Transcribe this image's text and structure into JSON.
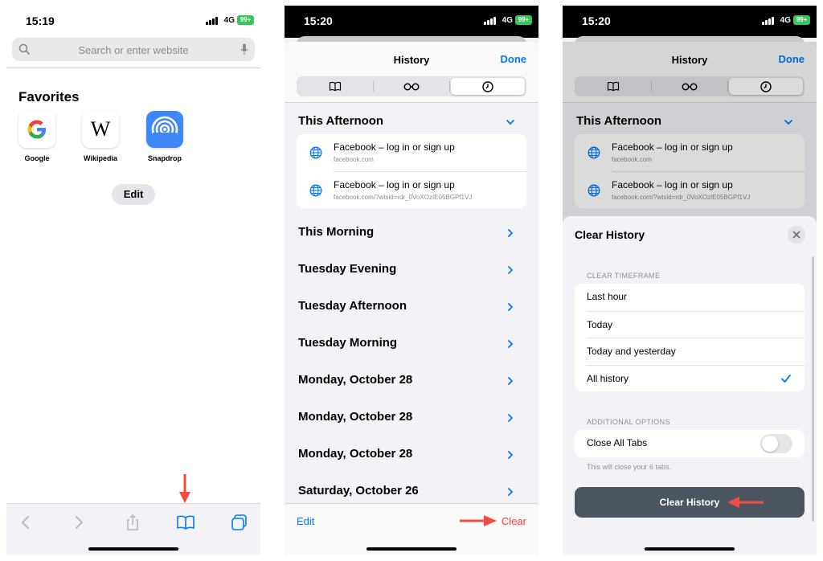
{
  "panel1": {
    "status": {
      "time": "15:19",
      "network": "4G",
      "battery": "99+"
    },
    "search": {
      "placeholder": "Search or enter website"
    },
    "favorites": {
      "title": "Favorites",
      "items": [
        {
          "label": "Google",
          "icon": "google-icon"
        },
        {
          "label": "Wikipedia",
          "icon": "wikipedia-icon"
        },
        {
          "label": "Snapdrop",
          "icon": "snapdrop-icon"
        }
      ]
    },
    "edit_label": "Edit"
  },
  "panel2": {
    "status": {
      "time": "15:20",
      "network": "4G",
      "battery": "99+"
    },
    "title": "History",
    "done_label": "Done",
    "sections": [
      "This Afternoon",
      "This Morning",
      "Tuesday Evening",
      "Tuesday Afternoon",
      "Tuesday Morning",
      "Monday, October 28",
      "Monday, October 28",
      "Monday, October 28",
      "Saturday, October 26"
    ],
    "entries": [
      {
        "title": "Facebook – log in or sign up",
        "url": "facebook.com"
      },
      {
        "title": "Facebook – log in or sign up",
        "url": "facebook.com/?wtsid=rdr_0VoXOzIE05BGPf1VJ"
      }
    ],
    "edit_label": "Edit",
    "clear_label": "Clear"
  },
  "panel3": {
    "status": {
      "time": "15:20",
      "network": "4G",
      "battery": "99+"
    },
    "title": "History",
    "done_label": "Done",
    "section": "This Afternoon",
    "entries": [
      {
        "title": "Facebook – log in or sign up",
        "url": "facebook.com"
      },
      {
        "title": "Facebook – log in or sign up",
        "url": "facebook.com/?wtsid=rdr_0VoXOzIE05BGPf1VJ"
      }
    ],
    "modal": {
      "title": "Clear History",
      "timeframe_header": "CLEAR TIMEFRAME",
      "options": [
        "Last hour",
        "Today",
        "Today and yesterday",
        "All history"
      ],
      "selected": "All history",
      "additional_header": "ADDITIONAL OPTIONS",
      "close_tabs_label": "Close All Tabs",
      "close_tabs_on": false,
      "note": "This will close your 6 tabs.",
      "button_label": "Clear History"
    }
  },
  "colors": {
    "accent": "#007aff",
    "destructive": "#ff3b30",
    "annotation_arrow": "#f24d41",
    "battery": "#34c759",
    "clear_button": "#4a5560"
  }
}
